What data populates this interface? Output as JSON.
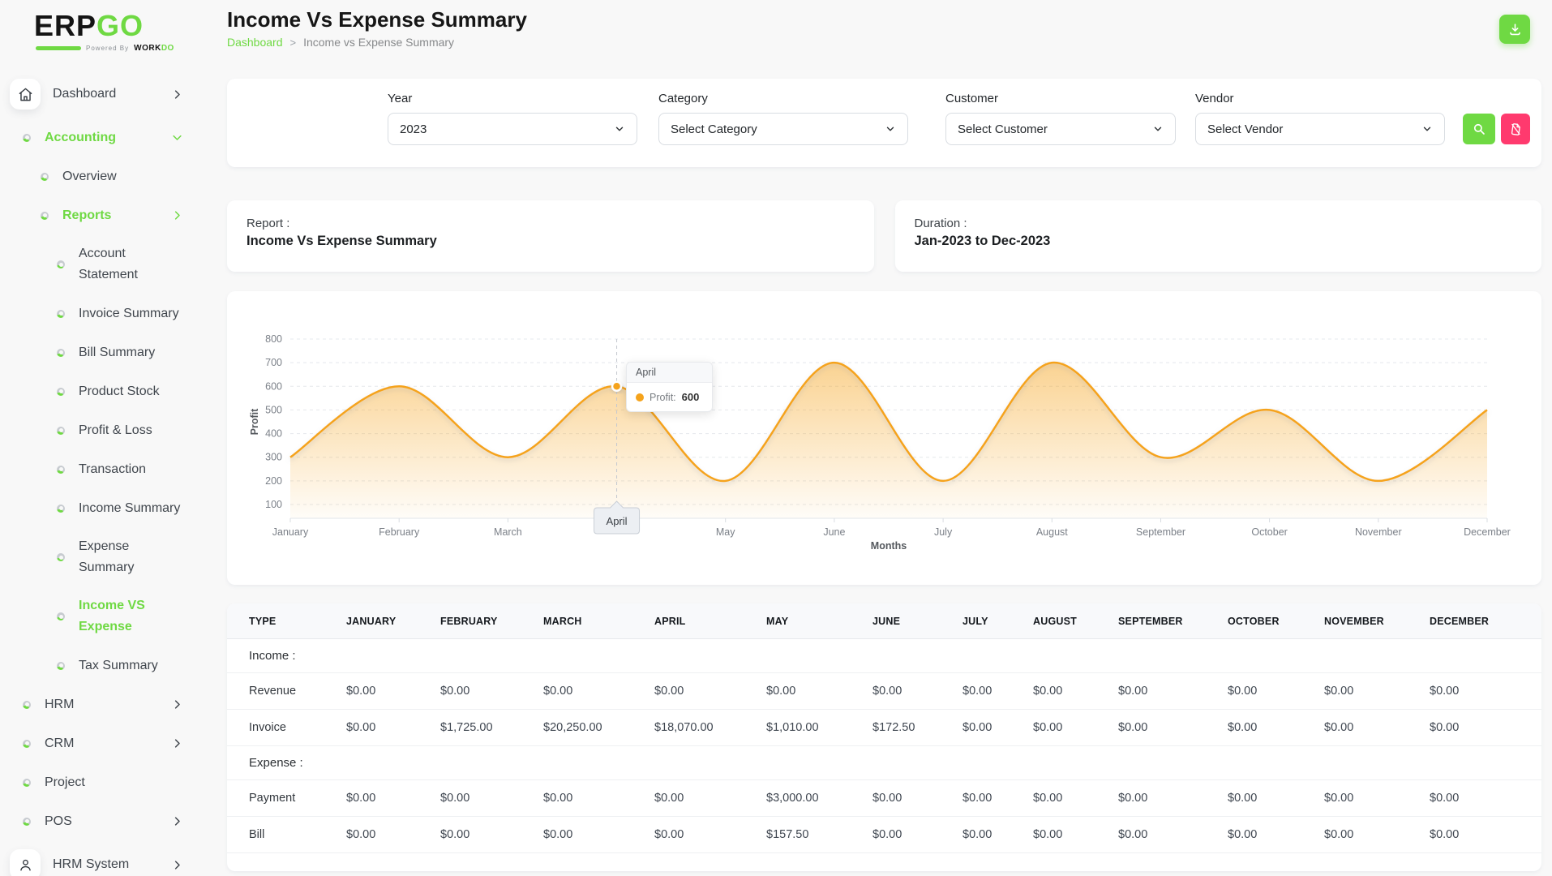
{
  "colors": {
    "accent_green": "#6fd943",
    "danger_pink": "#ff3a6e",
    "chart_orange": "#f5a31c"
  },
  "brand": {
    "logo_erp": "ERP",
    "logo_go": "GO",
    "powered_by": "Powered By",
    "workdo_work": "WORK",
    "workdo_do": "DO"
  },
  "sidebar": {
    "items": [
      {
        "label": "Dashboard",
        "level": 0,
        "icon": "home",
        "chevron": "right"
      },
      {
        "label": "Accounting",
        "level": 0,
        "bullet": true,
        "chevron": "down",
        "active": true
      },
      {
        "label": "Overview",
        "level": 1,
        "bullet": true
      },
      {
        "label": "Reports",
        "level": 1,
        "bullet": true,
        "chevron": "right",
        "active": true
      },
      {
        "label": "Account\nStatement",
        "level": 2,
        "bullet": true
      },
      {
        "label": "Invoice Summary",
        "level": 2,
        "bullet": true
      },
      {
        "label": "Bill Summary",
        "level": 2,
        "bullet": true
      },
      {
        "label": "Product Stock",
        "level": 2,
        "bullet": true
      },
      {
        "label": "Profit & Loss",
        "level": 2,
        "bullet": true
      },
      {
        "label": "Transaction",
        "level": 2,
        "bullet": true
      },
      {
        "label": "Income Summary",
        "level": 2,
        "bullet": true
      },
      {
        "label": "Expense\nSummary",
        "level": 2,
        "bullet": true
      },
      {
        "label": "Income VS\nExpense",
        "level": 2,
        "bullet": true,
        "active": true
      },
      {
        "label": "Tax Summary",
        "level": 2,
        "bullet": true
      },
      {
        "label": "HRM",
        "level": 0,
        "bullet": true,
        "chevron": "right"
      },
      {
        "label": "CRM",
        "level": 0,
        "bullet": true,
        "chevron": "right"
      },
      {
        "label": "Project",
        "level": 0,
        "bullet": true
      },
      {
        "label": "POS",
        "level": 0,
        "bullet": true,
        "chevron": "right"
      },
      {
        "label": "HRM System",
        "level": 0,
        "icon": "user",
        "chevron": "right"
      }
    ]
  },
  "header": {
    "title": "Income Vs Expense Summary",
    "breadcrumb_home": "Dashboard",
    "breadcrumb_separator": ">",
    "breadcrumb_current": "Income vs Expense Summary"
  },
  "filters": {
    "year_label": "Year",
    "year_value": "2023",
    "category_label": "Category",
    "category_value": "Select Category",
    "customer_label": "Customer",
    "customer_value": "Select Customer",
    "vendor_label": "Vendor",
    "vendor_value": "Select Vendor"
  },
  "cards": {
    "report_label": "Report :",
    "report_value": "Income Vs Expense Summary",
    "duration_label": "Duration :",
    "duration_value": "Jan-2023 to Dec-2023"
  },
  "chart_data": {
    "type": "area",
    "categories": [
      "January",
      "February",
      "March",
      "April",
      "May",
      "June",
      "July",
      "August",
      "September",
      "October",
      "November",
      "December"
    ],
    "series": [
      {
        "name": "Profit",
        "values": [
          300,
          600,
          300,
          600,
          200,
          700,
          200,
          700,
          300,
          500,
          200,
          500
        ]
      }
    ],
    "xlabel": "Months",
    "ylabel": "Profit",
    "ylim": [
      100,
      800
    ],
    "ytick_step": 100,
    "grid": "dashed-horizontal",
    "legend_position": "none",
    "line_color": "#f5a31c",
    "highlight": {
      "index": 3,
      "category": "April",
      "label": "Profit:",
      "value": 600
    }
  },
  "table": {
    "headers": [
      "TYPE",
      "JANUARY",
      "FEBRUARY",
      "MARCH",
      "APRIL",
      "MAY",
      "JUNE",
      "JULY",
      "AUGUST",
      "SEPTEMBER",
      "OCTOBER",
      "NOVEMBER",
      "DECEMBER"
    ],
    "rows": [
      {
        "kind": "section",
        "label": "Income :"
      },
      {
        "kind": "data",
        "label": "Revenue",
        "values": [
          "$0.00",
          "$0.00",
          "$0.00",
          "$0.00",
          "$0.00",
          "$0.00",
          "$0.00",
          "$0.00",
          "$0.00",
          "$0.00",
          "$0.00",
          "$0.00"
        ]
      },
      {
        "kind": "data",
        "label": "Invoice",
        "values": [
          "$0.00",
          "$1,725.00",
          "$20,250.00",
          "$18,070.00",
          "$1,010.00",
          "$172.50",
          "$0.00",
          "$0.00",
          "$0.00",
          "$0.00",
          "$0.00",
          "$0.00"
        ]
      },
      {
        "kind": "section",
        "label": "Expense :"
      },
      {
        "kind": "data",
        "label": "Payment",
        "values": [
          "$0.00",
          "$0.00",
          "$0.00",
          "$0.00",
          "$3,000.00",
          "$0.00",
          "$0.00",
          "$0.00",
          "$0.00",
          "$0.00",
          "$0.00",
          "$0.00"
        ]
      },
      {
        "kind": "data",
        "label": "Bill",
        "values": [
          "$0.00",
          "$0.00",
          "$0.00",
          "$0.00",
          "$157.50",
          "$0.00",
          "$0.00",
          "$0.00",
          "$0.00",
          "$0.00",
          "$0.00",
          "$0.00"
        ]
      }
    ]
  }
}
